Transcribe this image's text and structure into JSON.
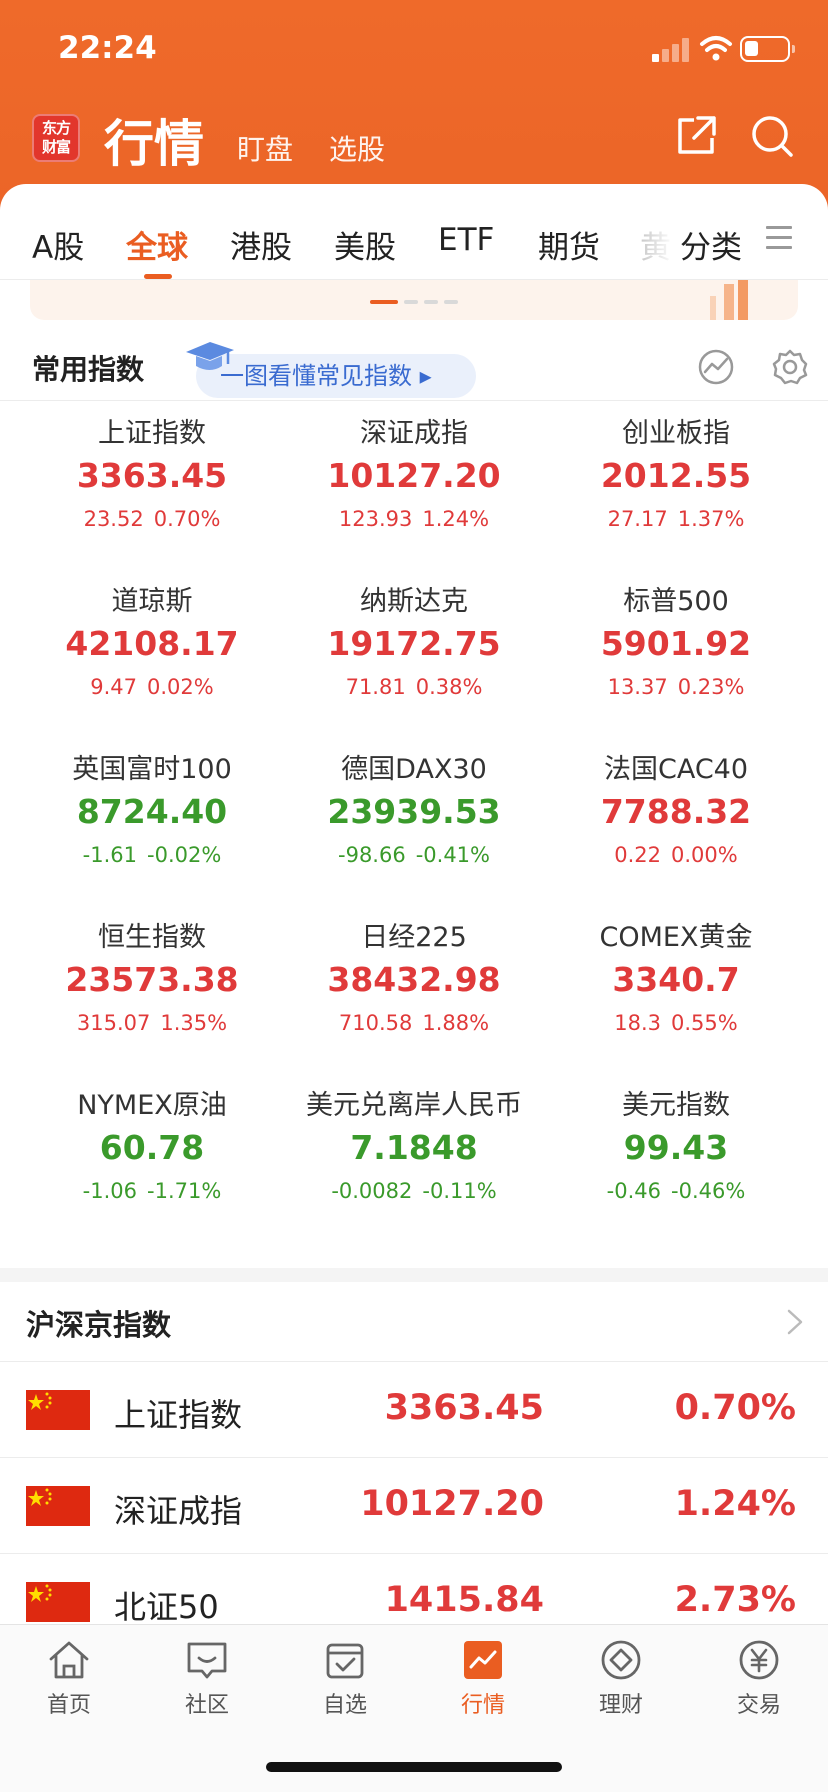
{
  "status_bar": {
    "time": "22:24"
  },
  "app_bar": {
    "logo_line1": "东方",
    "logo_line2": "财富",
    "title": "行情",
    "tabs": [
      "盯盘",
      "选股"
    ]
  },
  "market_tabs": {
    "items": [
      "A股",
      "全球",
      "港股",
      "美股",
      "ETF",
      "期货",
      "黄",
      "分类"
    ],
    "active": "全球"
  },
  "common_indices": {
    "title": "常用指数",
    "edu_link": "一图看懂常见指数 ▸",
    "items": [
      {
        "name": "上证指数",
        "price": "3363.45",
        "change": "23.52",
        "pct": "0.70%",
        "dir": "up"
      },
      {
        "name": "深证成指",
        "price": "10127.20",
        "change": "123.93",
        "pct": "1.24%",
        "dir": "up"
      },
      {
        "name": "创业板指",
        "price": "2012.55",
        "change": "27.17",
        "pct": "1.37%",
        "dir": "up"
      },
      {
        "name": "道琼斯",
        "price": "42108.17",
        "change": "9.47",
        "pct": "0.02%",
        "dir": "up"
      },
      {
        "name": "纳斯达克",
        "price": "19172.75",
        "change": "71.81",
        "pct": "0.38%",
        "dir": "up"
      },
      {
        "name": "标普500",
        "price": "5901.92",
        "change": "13.37",
        "pct": "0.23%",
        "dir": "up"
      },
      {
        "name": "英国富时100",
        "price": "8724.40",
        "change": "-1.61",
        "pct": "-0.02%",
        "dir": "down"
      },
      {
        "name": "德国DAX30",
        "price": "23939.53",
        "change": "-98.66",
        "pct": "-0.41%",
        "dir": "down"
      },
      {
        "name": "法国CAC40",
        "price": "7788.32",
        "change": "0.22",
        "pct": "0.00%",
        "dir": "up"
      },
      {
        "name": "恒生指数",
        "price": "23573.38",
        "change": "315.07",
        "pct": "1.35%",
        "dir": "up"
      },
      {
        "name": "日经225",
        "price": "38432.98",
        "change": "710.58",
        "pct": "1.88%",
        "dir": "up"
      },
      {
        "name": "COMEX黄金",
        "price": "3340.7",
        "change": "18.3",
        "pct": "0.55%",
        "dir": "up"
      },
      {
        "name": "NYMEX原油",
        "price": "60.78",
        "change": "-1.06",
        "pct": "-1.71%",
        "dir": "down"
      },
      {
        "name": "美元兑离岸人民币",
        "price": "7.1848",
        "change": "-0.0082",
        "pct": "-0.11%",
        "dir": "down"
      },
      {
        "name": "美元指数",
        "price": "99.43",
        "change": "-0.46",
        "pct": "-0.46%",
        "dir": "down"
      }
    ]
  },
  "hsj_indices": {
    "title": "沪深京指数",
    "rows": [
      {
        "name": "上证指数",
        "price": "3363.45",
        "pct": "0.70%"
      },
      {
        "name": "深证成指",
        "price": "10127.20",
        "pct": "1.24%"
      },
      {
        "name": "北证50",
        "price": "1415.84",
        "pct": "2.73%"
      }
    ]
  },
  "bottom_nav": {
    "items": [
      "首页",
      "社区",
      "自选",
      "行情",
      "理财",
      "交易"
    ],
    "active": "行情"
  },
  "colors": {
    "accent": "#ea5d21",
    "up": "#e03a3a",
    "down": "#3a9a2b",
    "header": "#ed6728"
  }
}
